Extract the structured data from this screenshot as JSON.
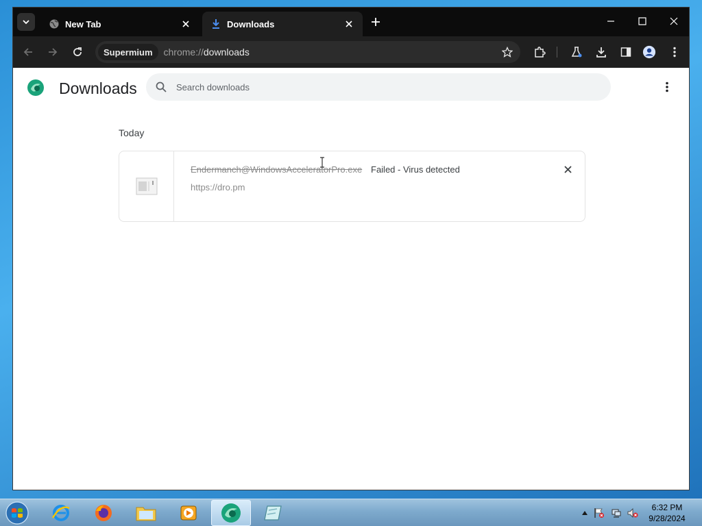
{
  "browser": {
    "tabs": [
      {
        "title": "New Tab",
        "icon": "globe-icon",
        "active": false
      },
      {
        "title": "Downloads",
        "icon": "download-icon",
        "active": true
      }
    ],
    "address_chip": "Supermium",
    "url_scheme": "chrome://",
    "url_host": "downloads"
  },
  "downloads_page": {
    "title": "Downloads",
    "search_placeholder": "Search downloads",
    "date_header": "Today",
    "items": [
      {
        "file_name": "Endermanch@WindowsAcceleratorPro.exe",
        "status": "Failed - Virus detected",
        "source_url": "https://dro.pm"
      }
    ]
  },
  "taskbar": {
    "time": "6:32 PM",
    "date": "9/28/2024"
  },
  "colors": {
    "accent_green": "#1aa37a",
    "tab_strip": "#0c0c0c",
    "toolbar": "#1f1f1f",
    "download_icon_blue": "#4b8ef0"
  }
}
